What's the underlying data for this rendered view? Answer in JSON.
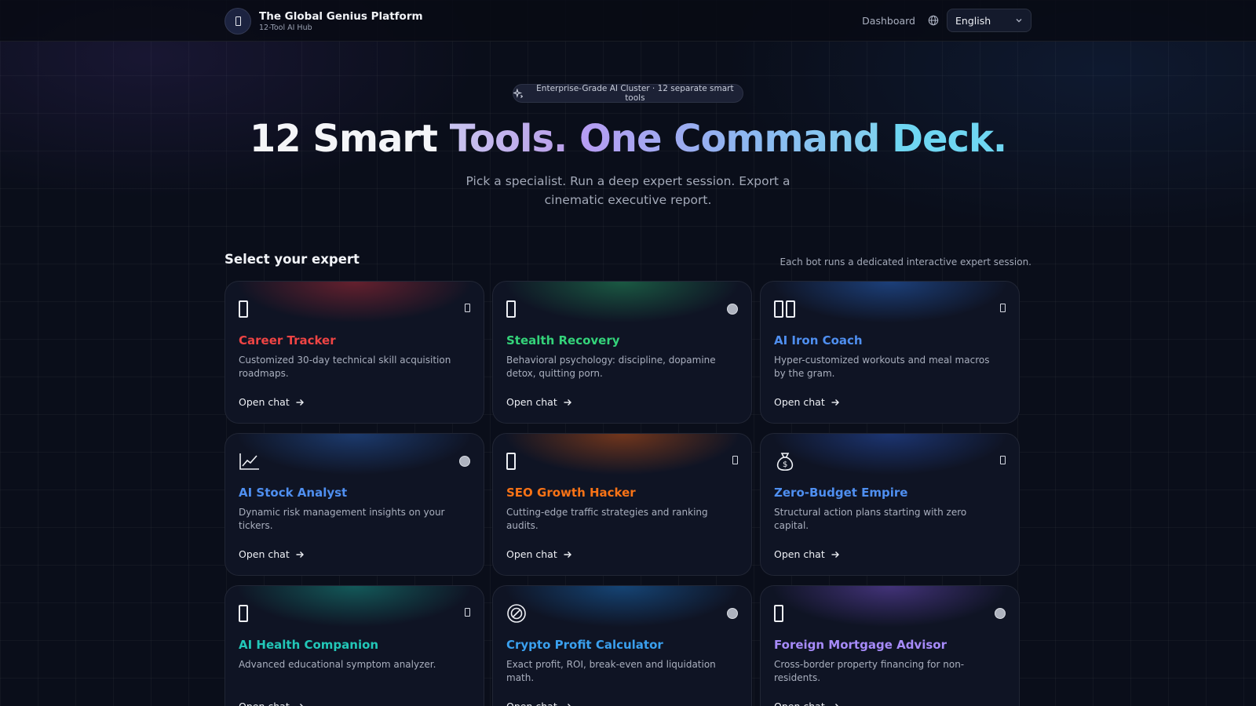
{
  "header": {
    "brand_title": "The Global Genius Platform",
    "brand_subtitle": "12-Tool AI Hub",
    "nav_dashboard": "Dashboard",
    "language": "English"
  },
  "hero": {
    "pill_text": "Enterprise-Grade AI Cluster · 12 separate smart tools",
    "headline_part1": "12 Smart ",
    "headline_part2": "Tools. ",
    "headline_part3": "One Command ",
    "headline_part4": "Deck.",
    "subtitle": "Pick a specialist. Run a deep expert session. Export a cinematic executive report."
  },
  "section": {
    "title": "Select your expert",
    "note": "Each bot runs a dedicated interactive expert session."
  },
  "cta_label": "Open chat",
  "cards": [
    {
      "title": "Career Tracker",
      "desc": "Customized 30-day technical skill acquisition roadmaps.",
      "color": "#ef4444",
      "glow": "#7a2330",
      "icon": "badge-icon",
      "corner": "rect"
    },
    {
      "title": "Stealth Recovery",
      "desc": "Behavioral psychology: discipline, dopamine detox, quitting porn.",
      "color": "#34d37a",
      "glow": "#1d6a4a",
      "icon": "shield-icon",
      "corner": "dot"
    },
    {
      "title": "AI Iron Coach",
      "desc": "Hyper-customized workouts and meal macros by the gram.",
      "color": "#4f8ff0",
      "glow": "#1f4a8f",
      "icon": "dumbbell-icon",
      "corner": "rect"
    },
    {
      "title": "AI Stock Analyst",
      "desc": "Dynamic risk management insights on your tickers.",
      "color": "#4f8ff0",
      "glow": "#1f4480",
      "icon": "chart-icon",
      "corner": "dot"
    },
    {
      "title": "SEO Growth Hacker",
      "desc": "Cutting-edge traffic strategies and ranking audits.",
      "color": "#f97316",
      "glow": "#8a3e1a",
      "icon": "rocket-icon",
      "corner": "rect"
    },
    {
      "title": "Zero-Budget Empire",
      "desc": "Structural action plans starting with zero capital.",
      "color": "#4f8ff0",
      "glow": "#1f3d85",
      "icon": "money-bag-icon",
      "corner": "rect"
    },
    {
      "title": "AI Health Companion",
      "desc": "Advanced educational symptom analyzer.",
      "color": "#22c7b8",
      "glow": "#146a66",
      "icon": "stethoscope-icon",
      "corner": "rect"
    },
    {
      "title": "Crypto Profit Calculator",
      "desc": "Exact profit, ROI, break-even and liquidation math.",
      "color": "#3aa0ee",
      "glow": "#165089",
      "icon": "coin-icon",
      "corner": "dot"
    },
    {
      "title": "Foreign Mortgage Advisor",
      "desc": "Cross-border property financing for non-residents.",
      "color": "#a78bfa",
      "glow": "#4f3a8e",
      "icon": "house-icon",
      "corner": "dot"
    }
  ]
}
